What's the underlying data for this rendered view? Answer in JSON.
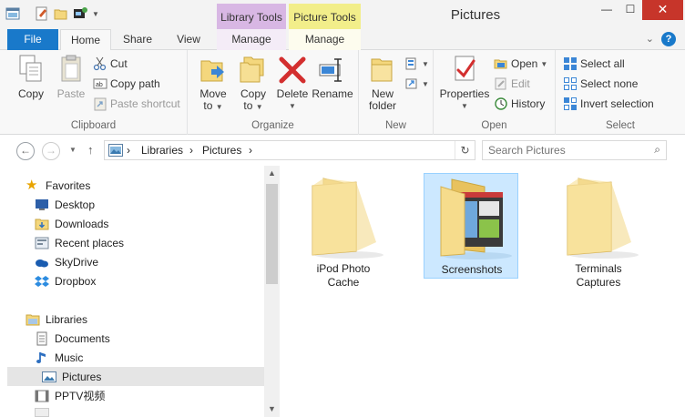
{
  "window": {
    "title": "Pictures",
    "context_tabs": {
      "library_tools": "Library Tools",
      "picture_tools": "Picture Tools"
    },
    "controls": {
      "minimize": "—",
      "maximize": "☐",
      "close": "✕"
    }
  },
  "ribbon_tabs": {
    "file": "File",
    "home": "Home",
    "share": "Share",
    "view": "View",
    "manage_library": "Manage",
    "manage_picture": "Manage",
    "help_icon": "?"
  },
  "ribbon": {
    "clipboard": {
      "label": "Clipboard",
      "copy": "Copy",
      "paste": "Paste",
      "cut": "Cut",
      "copy_path": "Copy path",
      "paste_shortcut": "Paste shortcut"
    },
    "organize": {
      "label": "Organize",
      "move_to": [
        "Move",
        "to"
      ],
      "copy_to": [
        "Copy",
        "to"
      ],
      "delete": "Delete",
      "rename": "Rename"
    },
    "new": {
      "label": "New",
      "new_folder": [
        "New",
        "folder"
      ]
    },
    "open": {
      "label": "Open",
      "properties": "Properties",
      "open": "Open",
      "edit": "Edit",
      "history": "History"
    },
    "select": {
      "label": "Select",
      "select_all": "Select all",
      "select_none": "Select none",
      "invert_selection": "Invert selection"
    }
  },
  "address": {
    "crumbs": [
      "Libraries",
      "Pictures"
    ],
    "separator": "›",
    "search_placeholder": "Search Pictures"
  },
  "nav": {
    "favorites": {
      "label": "Favorites",
      "items": [
        "Desktop",
        "Downloads",
        "Recent places",
        "SkyDrive",
        "Dropbox"
      ]
    },
    "libraries": {
      "label": "Libraries",
      "items": [
        "Documents",
        "Music",
        "Pictures",
        "PPTV视频"
      ]
    }
  },
  "folders": [
    {
      "name": [
        "iPod Photo",
        "Cache"
      ],
      "selected": false
    },
    {
      "name": [
        "Screenshots"
      ],
      "selected": true
    },
    {
      "name": [
        "Terminals",
        "Captures"
      ],
      "selected": false
    }
  ],
  "colors": {
    "file_tab": "#1979ca",
    "library_tools": "#d8b7e4",
    "picture_tools": "#f2ee8a",
    "close_button": "#c7352a",
    "selection": "#cce8ff",
    "folder": "#f4d77d"
  }
}
